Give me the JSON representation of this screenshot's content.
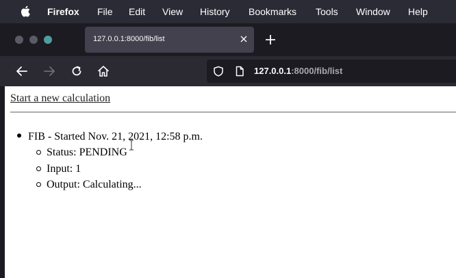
{
  "menubar": {
    "items": [
      "Firefox",
      "File",
      "Edit",
      "View",
      "History",
      "Bookmarks",
      "Tools",
      "Window",
      "Help"
    ]
  },
  "tab": {
    "title": "127.0.0.1:8000/fib/list"
  },
  "urlbar": {
    "host": "127.0.0.1",
    "path": ":8000/fib/list"
  },
  "page": {
    "new_calc_link": "Start a new calculation",
    "items": [
      {
        "title": "FIB - Started Nov. 21, 2021, 12:58 p.m.",
        "details": [
          "Status: PENDING",
          "Input: 1",
          "Output: Calculating..."
        ]
      }
    ]
  },
  "colors": {
    "menubar_bg": "#2b2b36",
    "tabstrip_bg": "#1c1b22",
    "active_tab_bg": "#42414d",
    "navbar_bg": "#2b2a33"
  }
}
